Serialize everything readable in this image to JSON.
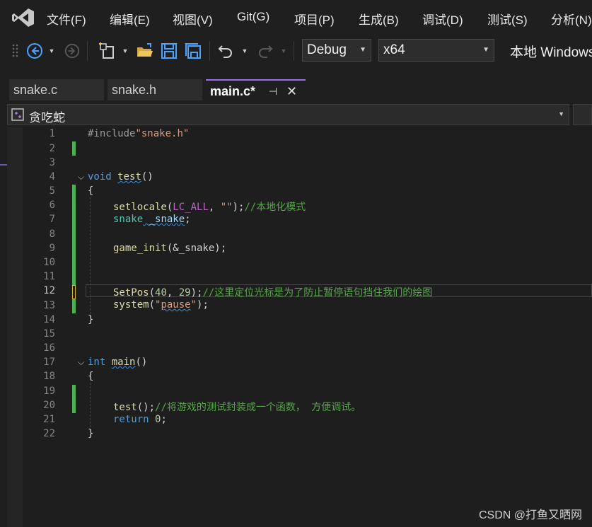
{
  "menu": [
    "文件(F)",
    "编辑(E)",
    "视图(V)",
    "Git(G)",
    "项目(P)",
    "生成(B)",
    "调试(D)",
    "测试(S)",
    "分析(N)"
  ],
  "toolbar": {
    "config": "Debug",
    "platform": "x64",
    "run_label": "本地 Windows"
  },
  "tabs": [
    {
      "label": "snake.c",
      "active": false
    },
    {
      "label": "snake.h",
      "active": false
    },
    {
      "label": "main.c*",
      "active": true
    }
  ],
  "navbar": {
    "project": "贪吃蛇"
  },
  "editor": {
    "line_numbers": [
      "1",
      "2",
      "3",
      "4",
      "5",
      "6",
      "7",
      "8",
      "9",
      "10",
      "11",
      "12",
      "13",
      "14",
      "15",
      "16",
      "17",
      "18",
      "19",
      "20",
      "21",
      "22"
    ],
    "current_line": "12",
    "code": {
      "l1_directive": "#include",
      "l1_file": "\"snake.h\"",
      "l4_kw": "void",
      "l4_fn": "test",
      "l4_rest": "()",
      "l5": "{",
      "l6_fn": "setlocale",
      "l6_open": "(",
      "l6_macro": "LC_ALL",
      "l6_mid": ", ",
      "l6_str": "\"\"",
      "l6_close": ");",
      "l6_cmt": "//本地化模式",
      "l7_type": "snake",
      "l7_var": " _snake",
      "l7_end": ";",
      "l9_fn": "game_init",
      "l9_args": "(&_snake);",
      "l12_fn": "SetPos",
      "l12_open": "(",
      "l12_n1": "40",
      "l12_mid": ", ",
      "l12_n2": "29",
      "l12_close": ");",
      "l12_cmt": "//这里定位光标是为了防止暂停语句挡住我们的绘图",
      "l13_fn": "system",
      "l13_open": "(",
      "l13_q1": "\"",
      "l13_word": "pause",
      "l13_q2": "\"",
      "l13_close": ");",
      "l14": "}",
      "l17_kw": "int",
      "l17_fn": "main",
      "l17_rest": "()",
      "l18": "{",
      "l20_fn": "test",
      "l20_rest": "();",
      "l20_cmt": "//将游戏的测试封装成一个函数， 方便调试。",
      "l21_kw": "return",
      "l21_num": " 0",
      "l21_end": ";",
      "l22": "}"
    }
  },
  "watermark": "CSDN @打鱼又晒网"
}
